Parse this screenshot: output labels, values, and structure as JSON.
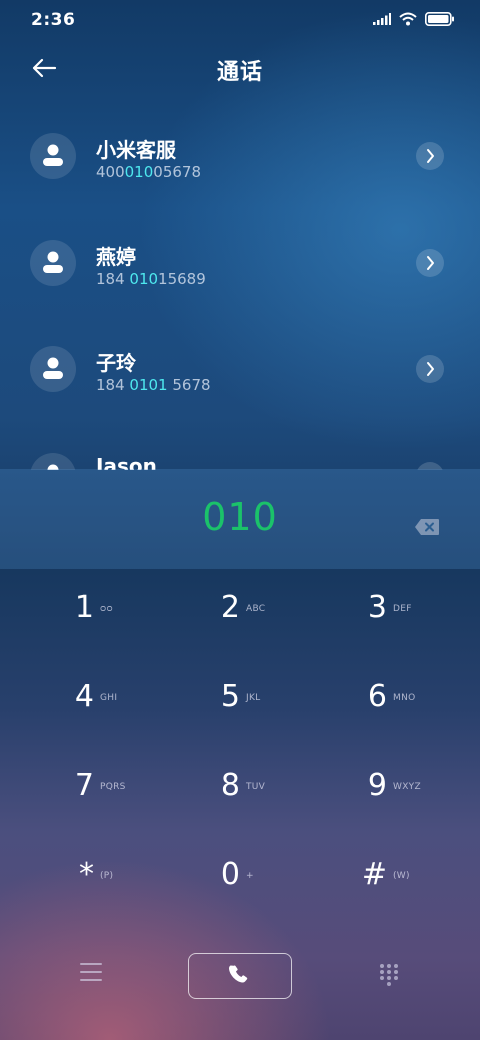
{
  "status_bar": {
    "time": "2:36"
  },
  "header": {
    "title": "通话"
  },
  "contacts": [
    {
      "name": "小米客服",
      "number_pre": "400",
      "number_hl": "010",
      "number_post": "05678"
    },
    {
      "name": "燕婷",
      "number_pre": "184 ",
      "number_hl": "010",
      "number_post": "15689"
    },
    {
      "name": "子玲",
      "number_pre": "184 ",
      "number_hl": "0101",
      "number_post": " 5678"
    },
    {
      "name": "Jason",
      "number_pre": "",
      "number_hl": "",
      "number_post": ""
    }
  ],
  "dial": {
    "entered_number": "010"
  },
  "keypad": [
    {
      "digit": "1",
      "letters": "ᴑᴑ"
    },
    {
      "digit": "2",
      "letters": "ABC"
    },
    {
      "digit": "3",
      "letters": "DEF"
    },
    {
      "digit": "4",
      "letters": "GHI"
    },
    {
      "digit": "5",
      "letters": "JKL"
    },
    {
      "digit": "6",
      "letters": "MNO"
    },
    {
      "digit": "7",
      "letters": "PQRS"
    },
    {
      "digit": "8",
      "letters": "TUV"
    },
    {
      "digit": "9",
      "letters": "WXYZ"
    },
    {
      "digit": "*",
      "letters": "(P)"
    },
    {
      "digit": "0",
      "letters": "+"
    },
    {
      "digit": "#",
      "letters": "(W)"
    }
  ],
  "colors": {
    "highlight": "#4ee8ee",
    "dial_number": "#1bc26a"
  },
  "icons": {
    "back": "arrow-left-icon",
    "chevron": "chevron-right-icon",
    "avatar": "person-icon",
    "backspace": "backspace-icon",
    "menu": "menu-icon",
    "call": "phone-icon",
    "dialpad": "dialpad-icon"
  }
}
